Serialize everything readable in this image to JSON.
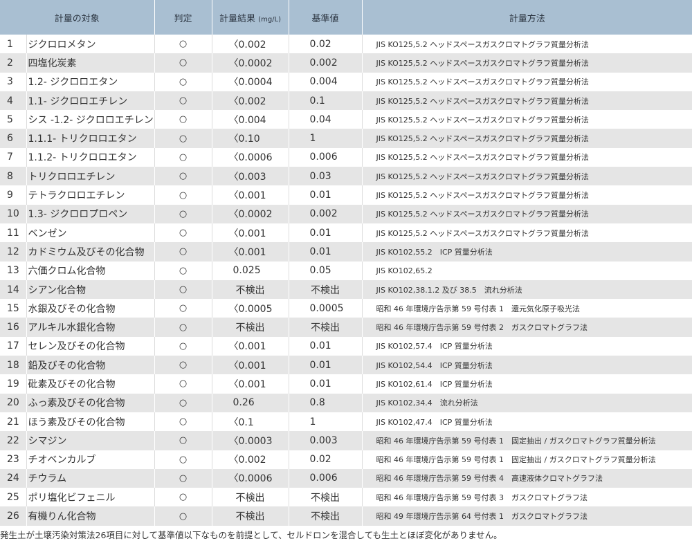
{
  "headers": {
    "target": "計量の対象",
    "judgment": "判定",
    "result": "計量結果",
    "result_unit": "(mg/L)",
    "standard": "基準値",
    "method": "計量方法"
  },
  "rows": [
    {
      "no": "1",
      "name": "ジクロロメタン",
      "judge": "○",
      "result": "〈0.002",
      "std": "0.02",
      "method": "JIS KO125,5.2 ヘッドスペースガスクロマトグラフ質量分析法"
    },
    {
      "no": "2",
      "name": "四塩化炭素",
      "judge": "○",
      "result": "〈0.0002",
      "std": "0.002",
      "method": "JIS KO125,5.2 ヘッドスペースガスクロマトグラフ質量分析法"
    },
    {
      "no": "3",
      "name": "1.2- ジクロロエタン",
      "judge": "○",
      "result": "〈0.0004",
      "std": "0.004",
      "method": "JIS KO125,5.2 ヘッドスペースガスクロマトグラフ質量分析法"
    },
    {
      "no": "4",
      "name": "1.1- ジクロロエチレン",
      "judge": "○",
      "result": "〈0.002",
      "std": "0.1",
      "method": "JIS KO125,5.2 ヘッドスペースガスクロマトグラフ質量分析法"
    },
    {
      "no": "5",
      "name": "シス -1.2- ジクロロエチレン",
      "judge": "○",
      "result": "〈0.004",
      "std": "0.04",
      "method": "JIS KO125,5.2 ヘッドスペースガスクロマトグラフ質量分析法"
    },
    {
      "no": "6",
      "name": "1.1.1- トリクロロエタン",
      "judge": "○",
      "result": "〈0.10",
      "std": "1",
      "method": "JIS KO125,5.2 ヘッドスペースガスクロマトグラフ質量分析法"
    },
    {
      "no": "7",
      "name": "1.1.2- トリクロロエタン",
      "judge": "○",
      "result": "〈0.0006",
      "std": "0.006",
      "method": "JIS KO125,5.2 ヘッドスペースガスクロマトグラフ質量分析法"
    },
    {
      "no": "8",
      "name": "トリクロロエチレン",
      "judge": "○",
      "result": "〈0.003",
      "std": "0.03",
      "method": "JIS KO125,5.2 ヘッドスペースガスクロマトグラフ質量分析法"
    },
    {
      "no": "9",
      "name": "テトラクロロエチレン",
      "judge": "○",
      "result": "〈0.001",
      "std": "0.01",
      "method": "JIS KO125,5.2 ヘッドスペースガスクロマトグラフ質量分析法"
    },
    {
      "no": "10",
      "name": "1.3- ジクロロプロペン",
      "judge": "○",
      "result": "〈0.0002",
      "std": "0.002",
      "method": "JIS KO125,5.2 ヘッドスペースガスクロマトグラフ質量分析法"
    },
    {
      "no": "11",
      "name": "ベンゼン",
      "judge": "○",
      "result": "〈0.001",
      "std": "0.01",
      "method": "JIS KO125,5.2 ヘッドスペースガスクロマトグラフ質量分析法"
    },
    {
      "no": "12",
      "name": "カドミウム及びその化合物",
      "judge": "○",
      "result": "〈0.001",
      "std": "0.01",
      "method": "JIS KO102,55.2　ICP 質量分析法"
    },
    {
      "no": "13",
      "name": "六価クロム化合物",
      "judge": "○",
      "result": "0.025",
      "std": "0.05",
      "method": "JIS KO102,65.2"
    },
    {
      "no": "14",
      "name": "シアン化合物",
      "judge": "○",
      "result": "不検出",
      "std": "不検出",
      "method": "JIS KO102,38.1.2 及び 38.5　流れ分析法"
    },
    {
      "no": "15",
      "name": "水銀及びその化合物",
      "judge": "○",
      "result": "〈0.0005",
      "std": "0.0005",
      "method": "昭和 46 年環境庁告示第 59 号付表 1　還元気化原子吸光法"
    },
    {
      "no": "16",
      "name": "アルキル水銀化合物",
      "judge": "○",
      "result": "不検出",
      "std": "不検出",
      "method": "昭和 46 年環境庁告示第 59 号付表 2　ガスクロマトグラフ法"
    },
    {
      "no": "17",
      "name": "セレン及びその化合物",
      "judge": "○",
      "result": "〈0.001",
      "std": "0.01",
      "method": "JIS KO102,57.4　ICP 質量分析法"
    },
    {
      "no": "18",
      "name": "鉛及びその化合物",
      "judge": "○",
      "result": "〈0.001",
      "std": "0.01",
      "method": "JIS KO102,54.4　ICP 質量分析法"
    },
    {
      "no": "19",
      "name": "砒素及びその化合物",
      "judge": "○",
      "result": "〈0.001",
      "std": "0.01",
      "method": "JIS KO102,61.4　ICP 質量分析法"
    },
    {
      "no": "20",
      "name": "ふっ素及びその化合物",
      "judge": "○",
      "result": "0.26",
      "std": "0.8",
      "method": "JIS KO102,34.4　流れ分析法"
    },
    {
      "no": "21",
      "name": "ほう素及びその化合物",
      "judge": "○",
      "result": "〈0.1",
      "std": "1",
      "method": "JIS KO102,47.4　ICP 質量分析法"
    },
    {
      "no": "22",
      "name": "シマジン",
      "judge": "○",
      "result": "〈0.0003",
      "std": "0.003",
      "method": "昭和 46 年環境庁告示第 59 号付表 1　固定抽出 / ガスクロマトグラフ質量分析法"
    },
    {
      "no": "23",
      "name": "チオベンカルブ",
      "judge": "○",
      "result": "〈0.002",
      "std": "0.02",
      "method": "昭和 46 年環境庁告示第 59 号付表 1　固定抽出 / ガスクロマトグラフ質量分析法"
    },
    {
      "no": "24",
      "name": "チウラム",
      "judge": "○",
      "result": "〈0.0006",
      "std": "0.006",
      "method": "昭和 46 年環境庁告示第 59 号付表 4　高速液体クロマトグラフ法"
    },
    {
      "no": "25",
      "name": "ポリ塩化ビフェニル",
      "judge": "○",
      "result": "不検出",
      "std": "不検出",
      "method": "昭和 46 年環境庁告示第 59 号付表 3　ガスクロマトグラフ法"
    },
    {
      "no": "26",
      "name": "有機りん化合物",
      "judge": "○",
      "result": "不検出",
      "std": "不検出",
      "method": "昭和 49 年環境庁告示第 64 号付表 1　ガスクロマトグラフ法"
    }
  ],
  "footnote": "発生土が土壌汚染対策法26項目に対して基準値以下なものを前提として、セルドロンを混合しても生土とほぼ変化がありません。",
  "colors": {
    "header_bg": "#a9bfd2",
    "row_alt_bg": "#e5e5e5",
    "text": "#333333"
  }
}
